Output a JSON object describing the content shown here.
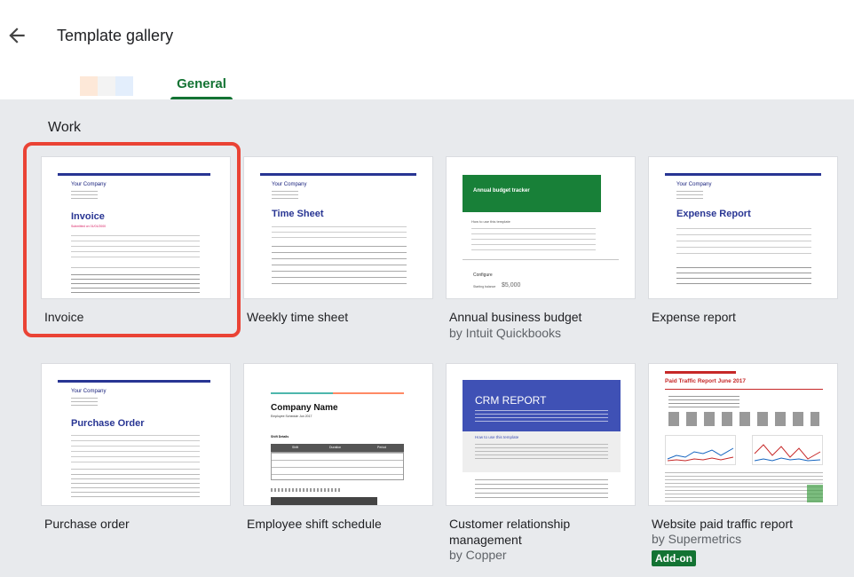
{
  "header": {
    "back_label": "back",
    "title": "Template gallery",
    "tab_general": "General"
  },
  "section": {
    "title": "Work"
  },
  "cards": [
    {
      "title": "Invoice",
      "subtitle": "",
      "thumb": {
        "company": "Your Company",
        "heading": "Invoice",
        "sub": "Submitted on 01/01/2000"
      }
    },
    {
      "title": "Weekly time sheet",
      "subtitle": "",
      "thumb": {
        "company": "Your Company",
        "heading": "Time Sheet"
      }
    },
    {
      "title": "Annual business budget",
      "subtitle": "by Intuit Quickbooks",
      "thumb": {
        "heading": "Annual budget tracker",
        "amount": "$5,000",
        "cat": "Configure",
        "label": "How to use this template",
        "amount_label": "Starting balance"
      }
    },
    {
      "title": "Expense report",
      "subtitle": "",
      "thumb": {
        "company": "Your Company",
        "heading": "Expense Report"
      }
    },
    {
      "title": "Purchase order",
      "subtitle": "",
      "thumb": {
        "company": "Your Company",
        "heading": "Purchase Order"
      }
    },
    {
      "title": "Employee shift schedule",
      "subtitle": "",
      "thumb": {
        "heading": "Company Name",
        "sub": "Employee Schedule Jun 2017",
        "shift": "Shift Details",
        "table_head": [
          "Shift",
          "Duration",
          "Period"
        ]
      }
    },
    {
      "title": "Customer relationship management",
      "subtitle": "by Copper",
      "thumb": {
        "heading": "CRM REPORT",
        "band": "How to use this template"
      }
    },
    {
      "title": "Website paid traffic report",
      "subtitle": "by Supermetrics",
      "badge": "Add-on",
      "thumb": {
        "heading": "Paid Traffic Report June 2017"
      }
    }
  ],
  "colors": {
    "accent_green": "#137333",
    "highlight_red": "#ea4335",
    "doc_blue": "#283593",
    "budget_green": "#188038",
    "crm_blue": "#3f51b5"
  },
  "icons": {
    "back": "arrow-left-icon"
  }
}
